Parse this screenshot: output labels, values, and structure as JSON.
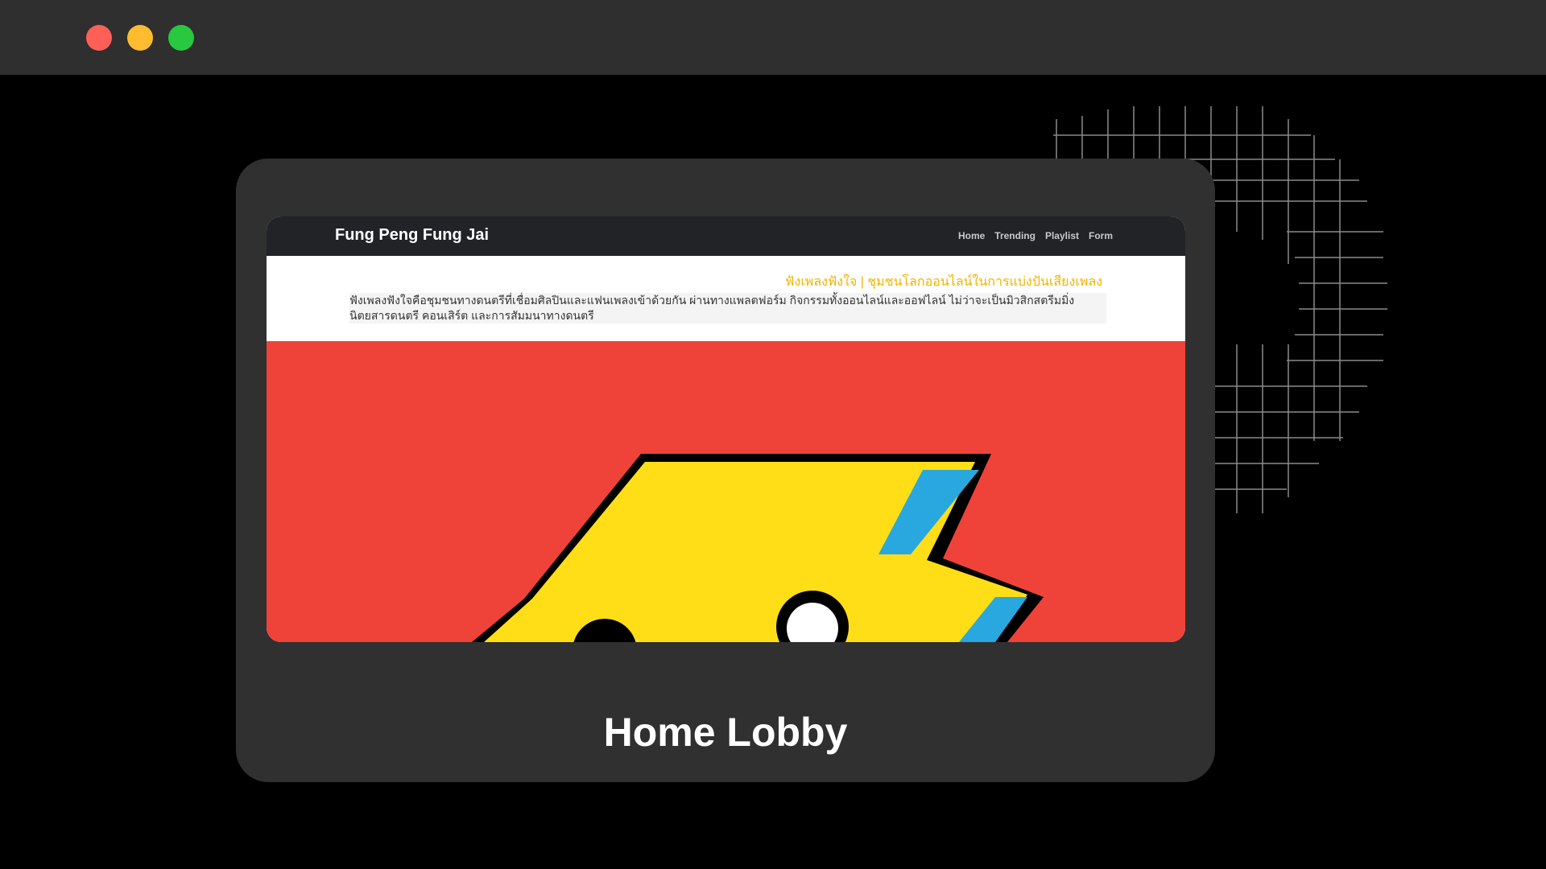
{
  "window": {
    "controls": [
      "close",
      "minimize",
      "maximize"
    ]
  },
  "site": {
    "brand": "Fung Peng Fung Jai",
    "nav": [
      "Home",
      "Trending",
      "Playlist",
      "Form"
    ],
    "intro_title": "ฟังเพลงฟังใจ | ชุมชนโลกออนไลน์ในการแบ่งปันเสียงเพลง",
    "intro_text": "ฟังเพลงฟังใจคือชุมชนทางดนตรีที่เชื่อมศิลปินและแฟนเพลงเข้าด้วยกัน ผ่านทางแพลตฟอร์ม กิจกรรมทั้งออนไลน์และออฟไลน์ ไม่ว่าจะเป็นมิวสิกสตรีมมิ่ง นิตยสารดนตรี คอนเสิร์ต และการสัมมนาทางดนตรี",
    "hero_icon": "lightning-mascot-logo"
  },
  "card": {
    "label": "Home Lobby"
  },
  "colors": {
    "titlebar": "#2f2f2f",
    "card": "#303030",
    "navbar": "#212326",
    "accent_title": "#f0b400",
    "hero_bg": "#ef4339",
    "bolt_yellow": "#ffde17",
    "bolt_blue": "#29a8e0"
  }
}
